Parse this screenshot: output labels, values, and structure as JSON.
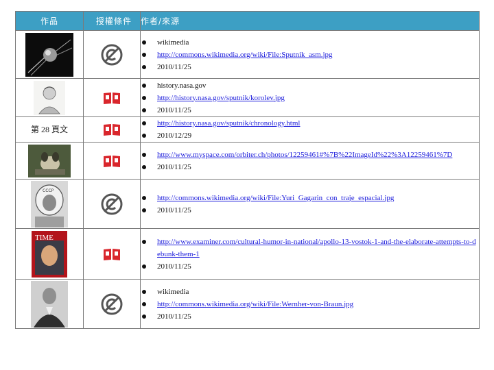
{
  "header": {
    "col_work": "作品",
    "col_license": "授權條件",
    "col_source": "作者/來源"
  },
  "colors": {
    "header_bg": "#3d9fc4",
    "header_text": "#ffffff",
    "link": "#1a1adb",
    "license_book": "#d9262c",
    "license_pd": "#555555"
  },
  "rows": [
    {
      "work": {
        "type": "image",
        "icon": "sputnik-satellite-photo"
      },
      "license": "public-domain-icon",
      "sources": [
        {
          "text": "wikimedia",
          "link": false
        },
        {
          "text": "http://commons.wikimedia.org/wiki/File:Sputnik_asm.jpg",
          "link": true
        },
        {
          "text": "2010/11/25",
          "link": false
        }
      ]
    },
    {
      "work": {
        "type": "image",
        "icon": "korolev-portrait-sketch"
      },
      "license": "copyright-book-icon",
      "sources": [
        {
          "text": "history.nasa.gov",
          "link": false
        },
        {
          "text": "http://history.nasa.gov/sputnik/korolev.jpg",
          "link": true
        },
        {
          "text": "2010/11/25",
          "link": false
        }
      ]
    },
    {
      "work": {
        "type": "text",
        "text": "第 28 頁文"
      },
      "license": "copyright-book-icon",
      "sources": [
        {
          "text": "http://history.nasa.gov/sputnik/chronology.html",
          "link": true
        },
        {
          "text": "2010/12/29",
          "link": false
        }
      ]
    },
    {
      "work": {
        "type": "image",
        "icon": "laika-dog-photo"
      },
      "license": "copyright-book-icon",
      "sources": [
        {
          "text": "http://www.myspace.com/orbiter.ch/photos/12259461#%7B%22ImageId%22%3A12259461%7D",
          "link": true
        },
        {
          "text": "2010/11/25",
          "link": false
        }
      ]
    },
    {
      "work": {
        "type": "image",
        "icon": "gagarin-helmet-photo"
      },
      "license": "public-domain-icon",
      "sources": [
        {
          "text": "http://commons.wikimedia.org/wiki/File:Yuri_Gagarin_con_traje_espacial.jpg",
          "link": true
        },
        {
          "text": "2010/11/25",
          "link": false
        }
      ]
    },
    {
      "work": {
        "type": "image",
        "icon": "time-magazine-cover",
        "overlay_text": "TIME"
      },
      "license": "copyright-book-icon",
      "sources": [
        {
          "text": "http://www.examiner.com/cultural-humor-in-national/apollo-13-vostok-1-and-the-elaborate-attempts-to-debunk-them-1",
          "link": true
        },
        {
          "text": "2010/11/25",
          "link": false
        }
      ]
    },
    {
      "work": {
        "type": "image",
        "icon": "von-braun-photo"
      },
      "license": "public-domain-icon",
      "sources": [
        {
          "text": "wikimedia",
          "link": false
        },
        {
          "text": "http://commons.wikimedia.org/wiki/File:Wernher-von-Braun.jpg",
          "link": true
        },
        {
          "text": "2010/11/25",
          "link": false
        }
      ]
    }
  ]
}
